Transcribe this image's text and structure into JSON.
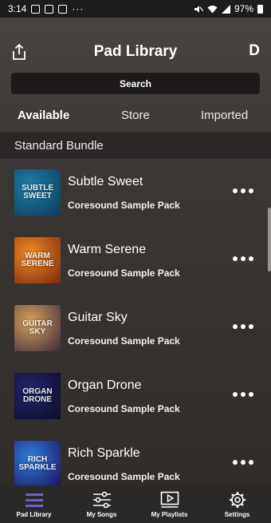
{
  "status_bar": {
    "time": "3:14",
    "dots": "···",
    "battery": "97%"
  },
  "header": {
    "title": "Pad Library",
    "edit_label": "D"
  },
  "search": {
    "label": "Search"
  },
  "tabs": [
    {
      "label": "Available",
      "active": true
    },
    {
      "label": "Store",
      "active": false
    },
    {
      "label": "Imported",
      "active": false
    }
  ],
  "section_title": "Standard Bundle",
  "items": [
    {
      "name": "Subtle Sweet",
      "pack": "Coresound Sample Pack",
      "art_text": "SUBTLE SWEET",
      "art_colors": [
        "#1e7fa6",
        "#0c3b5a"
      ]
    },
    {
      "name": "Warm Serene",
      "pack": "Coresound Sample Pack",
      "art_text": "WARM SERENE",
      "art_colors": [
        "#f08a24",
        "#7a2a0c"
      ]
    },
    {
      "name": "Guitar Sky",
      "pack": "Coresound Sample Pack",
      "art_text": "GUITAR SKY",
      "art_colors": [
        "#d9a15a",
        "#3a2a3e"
      ]
    },
    {
      "name": "Organ Drone",
      "pack": "Coresound Sample Pack",
      "art_text": "ORGAN DRONE",
      "art_colors": [
        "#24246e",
        "#0d0d2a"
      ]
    },
    {
      "name": "Rich Sparkle",
      "pack": "Coresound Sample Pack",
      "art_text": "RICH SPARKLE",
      "art_colors": [
        "#2b7fe0",
        "#20105a"
      ]
    }
  ],
  "bottom_nav": [
    {
      "label": "Pad Library",
      "icon": "list-icon",
      "active": true
    },
    {
      "label": "My Songs",
      "icon": "sliders-icon",
      "active": false
    },
    {
      "label": "My Playlists",
      "icon": "playlist-icon",
      "active": false
    },
    {
      "label": "Settings",
      "icon": "gear-icon",
      "active": false
    }
  ],
  "colors": {
    "nav_active": "#6a5fd1"
  }
}
